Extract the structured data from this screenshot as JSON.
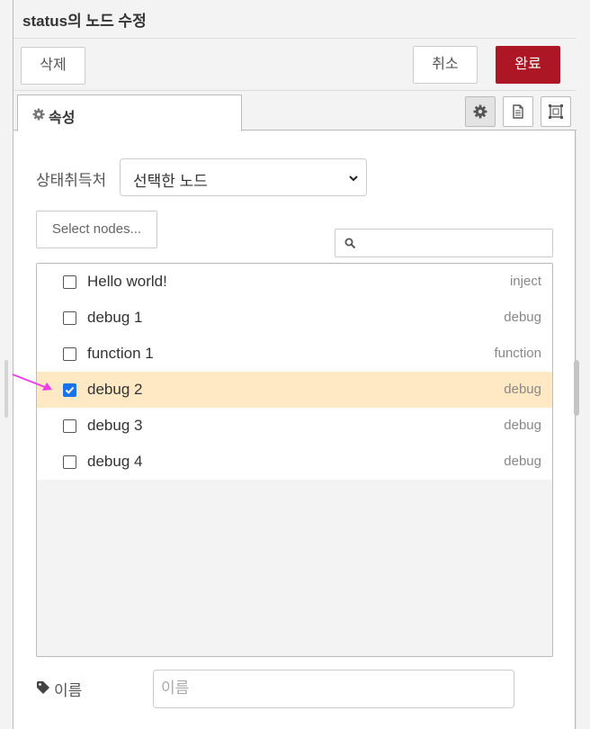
{
  "header": {
    "title": "status의 노드 수정"
  },
  "toolbar": {
    "delete_label": "삭제",
    "cancel_label": "취소",
    "done_label": "완료"
  },
  "tabs": {
    "active_label": "속성"
  },
  "form": {
    "source_label": "상태취득처",
    "source_value": "선택한 노드",
    "select_nodes_label": "Select nodes...",
    "name_label": "이름",
    "name_placeholder": "이름"
  },
  "nodes": [
    {
      "name": "Hello world!",
      "type": "inject",
      "checked": false
    },
    {
      "name": "debug 1",
      "type": "debug",
      "checked": false
    },
    {
      "name": "function 1",
      "type": "function",
      "checked": false
    },
    {
      "name": "debug 2",
      "type": "debug",
      "checked": true
    },
    {
      "name": "debug 3",
      "type": "debug",
      "checked": false
    },
    {
      "name": "debug 4",
      "type": "debug",
      "checked": false
    }
  ],
  "colors": {
    "done_button": "#ad1625",
    "selected_row": "#ffe8c4",
    "checkbox_checked": "#1a73e8",
    "annotation_arrow": "#f03ce6"
  },
  "icons": [
    "gear-icon",
    "description-icon",
    "appearance-icon",
    "chevron-down-icon",
    "search-icon",
    "tag-icon",
    "check-icon"
  ]
}
